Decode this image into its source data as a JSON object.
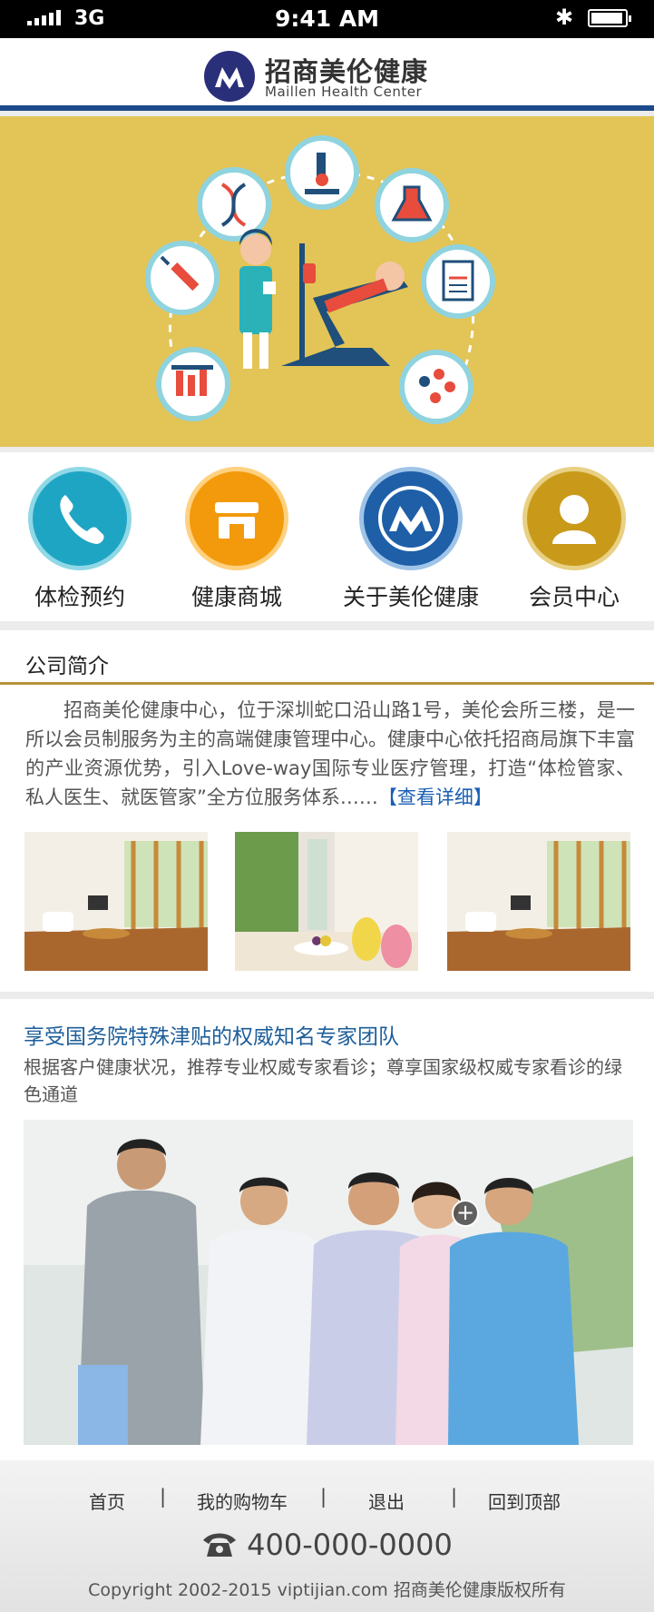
{
  "status_bar": {
    "carrier": "3G",
    "time": "9:41 AM"
  },
  "header": {
    "brand_cn": "招商美伦健康",
    "brand_en": "Maillen Health Center"
  },
  "quick_nav": [
    {
      "label": "体检预约",
      "icon": "phone-icon",
      "color": "#1fa5c4"
    },
    {
      "label": "健康商城",
      "icon": "shop-icon",
      "color": "#f29a0b"
    },
    {
      "label": "关于美伦健康",
      "icon": "brand-logo-icon",
      "color": "#1e5fa8"
    },
    {
      "label": "会员中心",
      "icon": "user-icon",
      "color": "#c99a1a"
    }
  ],
  "intro": {
    "title": "公司简介",
    "text": "招商美伦健康中心，位于深圳蛇口沿山路1号，美伦会所三楼，是一所以会员制服务为主的高端健康管理中心。健康中心依托招商局旗下丰富的产业资源优势，引入Love-way国际专业医疗管理，打造“体检管家、私人医生、就医管家”全方位服务体系……",
    "more_link": "【查看详细】"
  },
  "experts": {
    "title": "享受国务院特殊津贴的权威知名专家团队",
    "description": "根据客户健康状况，推荐专业权威专家看诊；尊享国家级权威专家看诊的绿色通道"
  },
  "footer": {
    "nav": [
      "首页",
      "我的购物车",
      "退出",
      "回到顶部"
    ],
    "separator": "|",
    "phone": "400-000-0000",
    "copyright": "Copyright 2002-2015 viptijian.com  招商美伦健康版权所有"
  },
  "colors": {
    "header_bar": "#1d4a8a",
    "banner_bg": "#e2c457",
    "intro_rule": "#b8923a",
    "expert_title": "#1d5e9a",
    "link": "#1a5fb4"
  }
}
